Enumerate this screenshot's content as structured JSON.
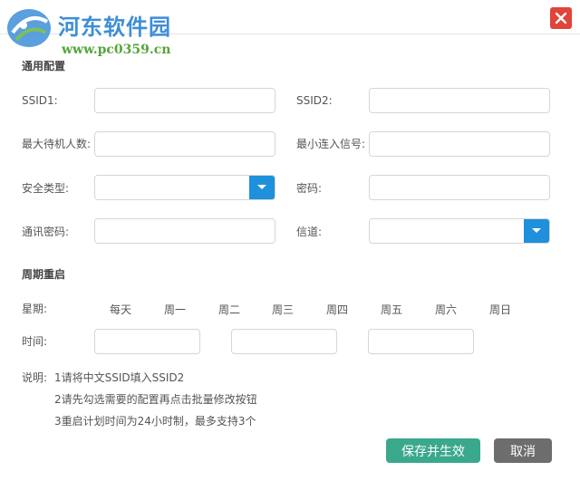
{
  "watermark": {
    "title": "河东软件园",
    "url": "www.pc0359.cn"
  },
  "general": {
    "section_title": "通用配置",
    "ssid1": {
      "label": "SSID1:",
      "value": ""
    },
    "ssid2": {
      "label": "SSID2:",
      "value": ""
    },
    "max_standby": {
      "label": "最大待机人数:",
      "value": ""
    },
    "min_signal": {
      "label": "最小连入信号:",
      "value": ""
    },
    "security_type": {
      "label": "安全类型:",
      "value": ""
    },
    "password": {
      "label": "密码:",
      "value": ""
    },
    "comm_password": {
      "label": "通讯密码:",
      "value": ""
    },
    "channel": {
      "label": "信道:",
      "value": ""
    }
  },
  "reboot": {
    "section_title": "周期重启",
    "weekday_label": "星期:",
    "days": [
      "每天",
      "周一",
      "周二",
      "周三",
      "周四",
      "周五",
      "周六",
      "周日"
    ],
    "time_label": "时间:",
    "times": [
      "",
      "",
      ""
    ]
  },
  "notes": {
    "label": "说明:",
    "lines": [
      "1请将中文SSID填入SSID2",
      "2请先勾选需要的配置再点击批量修改按钮",
      "3重启计划时间为24小时制，最多支持3个"
    ]
  },
  "buttons": {
    "save": "保存并生效",
    "cancel": "取消"
  },
  "colors": {
    "close": "#e0443a",
    "dropdown_arrow": "#1e90dc",
    "save": "#3aa88d",
    "cancel": "#6d6d6d"
  },
  "icons": {
    "close": "close-icon",
    "dropdown": "chevron-down-icon",
    "logo": "site-logo-icon"
  }
}
